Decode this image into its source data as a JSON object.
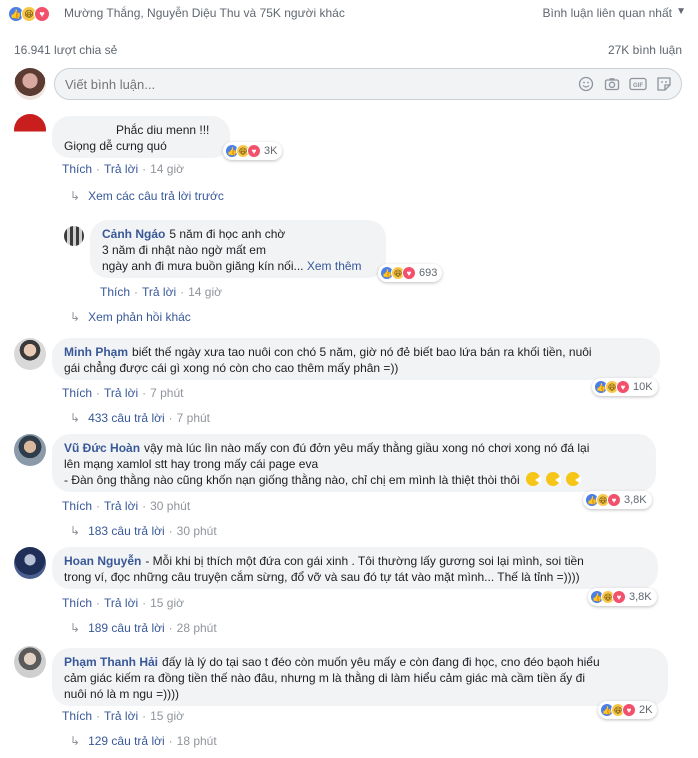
{
  "top": {
    "reaction_names": "Mường Thắng, Nguyễn Diệu Thu và 75K người khác",
    "sort_label": "Bình luận liên quan nhất",
    "sort_caret": "▼"
  },
  "stats": {
    "shares": "16.941 lượt chia sẻ",
    "comments": "27K bình luận"
  },
  "composer": {
    "placeholder": "Viết bình luận...",
    "icons": [
      "emoji-icon",
      "camera-icon",
      "gif-icon",
      "sticker-icon"
    ]
  },
  "actions": {
    "like": "Thích",
    "reply": "Trả lời",
    "sep": "·"
  },
  "comments": [
    {
      "author": "",
      "text_line1": "Phắc diu menn !!!",
      "text_line2": "Giọng dễ cưng quó",
      "reactions": "3K",
      "time": "14 giờ",
      "replies_link": "Xem các câu trả lời trước"
    },
    {
      "author": "Cảnh Ngáo",
      "text_line1": "5 năm đi học anh chờ",
      "text_line2": "3 năm đi nhật nào ngờ mất em",
      "text_line3": "ngày anh đi mưa buồn giăng kín nối...",
      "see_more": "Xem thêm",
      "reactions": "693",
      "time": "14 giờ",
      "replies_link": "Xem phản hồi khác"
    },
    {
      "author": "Minh Phạm",
      "text_line1": "biết thế ngày xưa tao nuôi con chó 5 năm, giờ nó đẻ biết bao lứa bán ra khối tiền, nuôi",
      "text_line2": "gái chẳng được cái gì xong nó còn cho cao thêm mấy phân =))",
      "reactions": "10K",
      "time": "7 phút",
      "replies_link": "433 câu trả lời"
    },
    {
      "author": "Vũ Đức Hoàn",
      "text_line1": "vậy mà lúc lìn nào mấy con đú đởn yêu mấy thằng giầu xong nó chơi xong nó đá lại",
      "text_line2": "lên mạng xamlol stt hay trong mấy cái page eva",
      "text_line3": "- Đàn ông thằng nào cũng khốn nạn giống thằng nào, chỉ chị em mình là thiệt thòi thôi",
      "reactions": "3,8K",
      "time": "30 phút",
      "replies_link": "183 câu trả lời"
    },
    {
      "author": "Hoan Nguyễn",
      "text_line1": "- Mỗi khi bị thích một đứa con gái xinh . Tôi thường lấy gương soi lại mình, soi tiền",
      "text_line2": "trong ví, đọc những câu truyện cắm sừng, đổ vỡ và sau đó tự tát vào mặt mình... Thế là tỉnh =))))",
      "reactions": "3,8K",
      "time": "15 giờ",
      "replies_link": "189 câu trả lời"
    },
    {
      "author": "Phạm Thanh Hải",
      "text_line1": "đấy là lý do tại sao t đéo còn muốn yêu mấy e còn đang đi học, cno đéo bạoh hiểu",
      "text_line2": "cảm giác kiếm ra đồng tiền thế nào đâu, nhưng m là thằng di làm hiểu cảm giác mà cầm tiền ấy đi",
      "text_line3": "nuôi nó là m ngu =))))",
      "reactions": "2K",
      "time": "15 giờ",
      "replies_link": "129 câu trả lời"
    }
  ],
  "reply_time": {
    "c3": "7 phút",
    "c4": "30 phút",
    "c5": "28 phút",
    "c6": "18 phút"
  }
}
